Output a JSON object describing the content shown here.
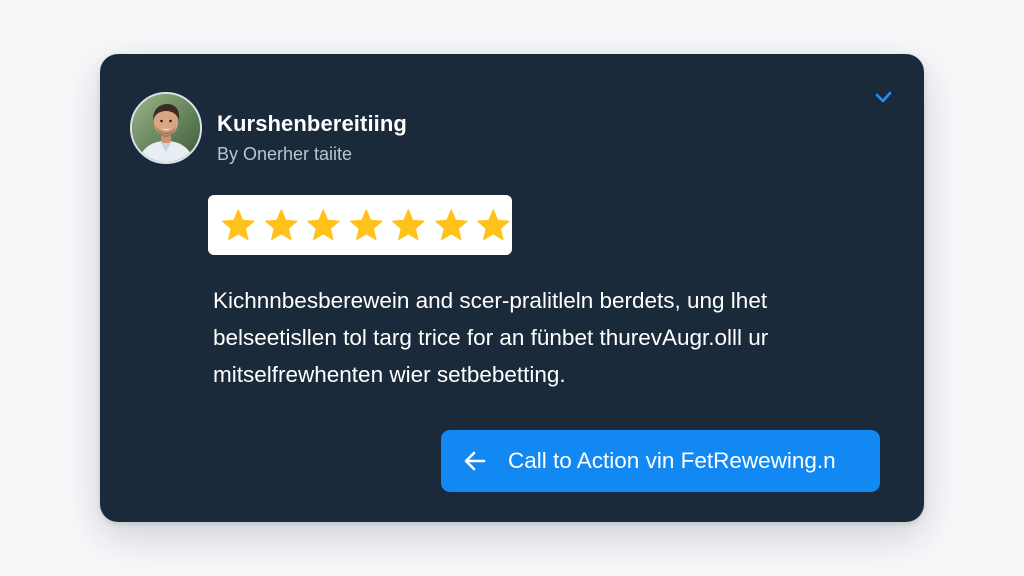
{
  "review_card": {
    "reviewer": {
      "name": "Kurshenbereitiing",
      "byline": "By Onerher taiite"
    },
    "collapse_icon": "chevron-down-icon",
    "rating": {
      "stars": 7,
      "icon": "star-icon",
      "color": "#ffc21a"
    },
    "review_text": {
      "line1": "Kichnnbesberewein and scer-pralitleln berdets, ung lhet",
      "line2": "belseetisllen tol targ trice for an fünbet thurevAugr.olll ur",
      "line3": "mitselfrewhenten wier setbebetting."
    },
    "cta": {
      "icon": "arrow-left-icon",
      "label": "Call to Action vin FetRewewing.n"
    }
  },
  "colors": {
    "page_background": "#f7f8fa",
    "card_background": "#1b2a3b",
    "accent": "#1288f3",
    "star": "#ffc21a",
    "text_primary": "#ffffff",
    "text_secondary": "#b9c4cf"
  }
}
